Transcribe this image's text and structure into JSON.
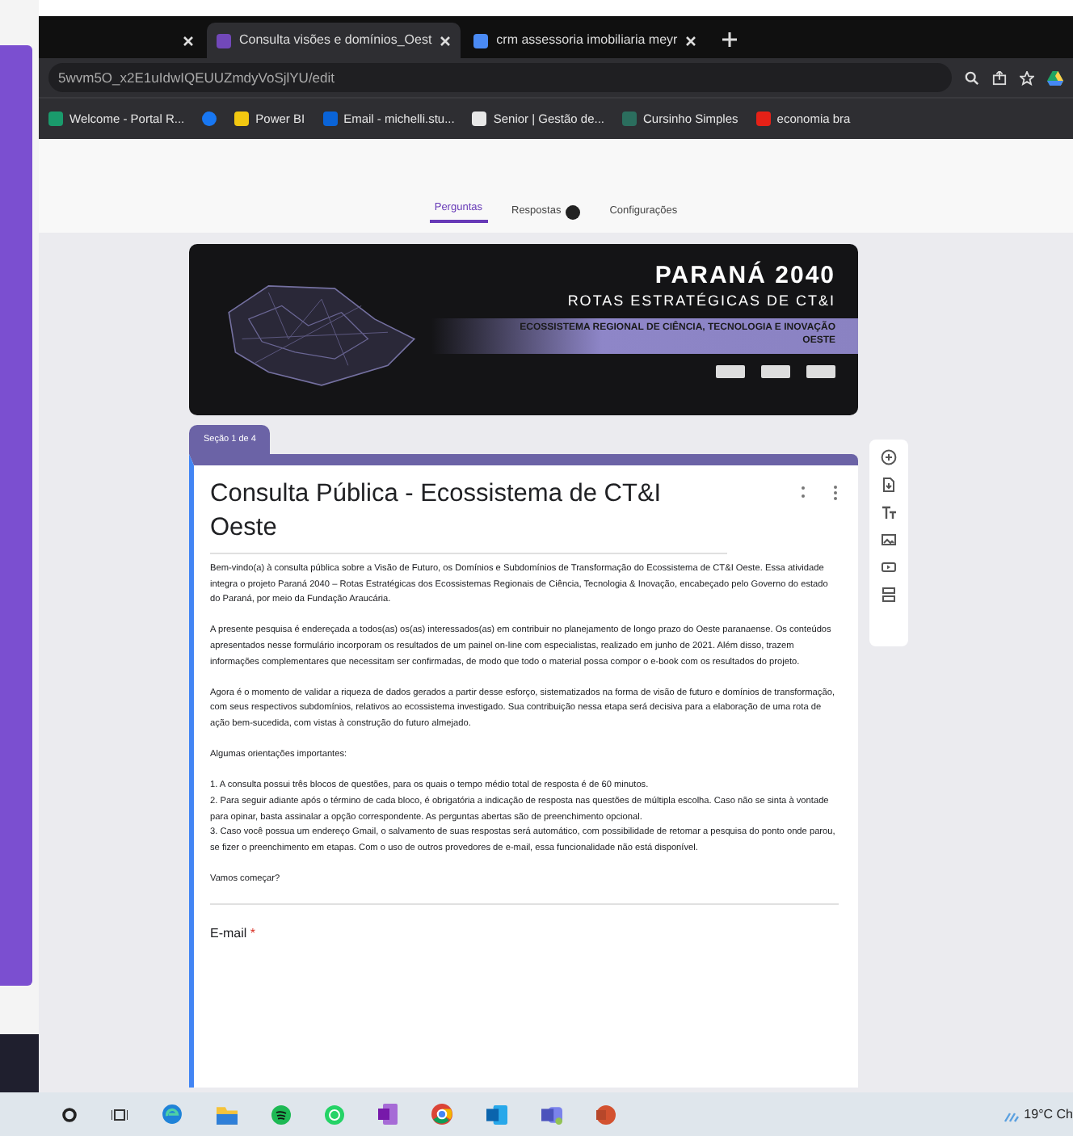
{
  "browser": {
    "tabs": [
      {
        "selected": false
      },
      {
        "title": "Consulta visões e domínios_Oest",
        "selected": true
      },
      {
        "title": "crm assessoria imobiliaria meyr",
        "selected": false
      }
    ],
    "url": "5wvm5O_x2E1uIdwIQEUUZmdyVoSjlYU/edit",
    "bookmarks": [
      {
        "label": "Welcome - Portal R...",
        "color": "#1a9b6c"
      },
      {
        "color": "#1877f2"
      },
      {
        "label": "Power BI",
        "color": "#f2c811"
      },
      {
        "label": "Email - michelli.stu...",
        "color": "#0a64d8"
      },
      {
        "label": "Senior | Gestão de...",
        "color": "#e8e8e8"
      },
      {
        "label": "Cursinho Simples",
        "color": "#2b6e5e"
      },
      {
        "label": "economia bra",
        "color": "#e62117"
      }
    ]
  },
  "form": {
    "tabs": [
      {
        "label": "Perguntas",
        "selected": true,
        "badge": false
      },
      {
        "label": "Respostas",
        "selected": false,
        "badge": true
      },
      {
        "label": "Configurações",
        "selected": false,
        "badge": false
      }
    ],
    "banner": {
      "title": "PARANÁ 2040",
      "subtitle": "ROTAS ESTRATÉGICAS DE CT&I",
      "region": "ECOSSISTEMA REGIONAL DE CIÊNCIA, TECNOLOGIA E INOVAÇÃO OESTE"
    },
    "section_label": "Seção 1 de 4",
    "title": "Consulta Pública - Ecossistema de CT&I Oeste",
    "description": [
      {
        "kind": "paragraph",
        "text": "Bem-vindo(a) à consulta pública sobre a Visão de Futuro, os Domínios e Subdomínios de Transformação do Ecossistema de CT&I Oeste. Essa atividade integra o projeto Paraná 2040 – Rotas Estratégicas dos Ecossistemas Regionais de Ciência, Tecnologia & Inovação, encabeçado pelo Governo do estado do Paraná, por meio da Fundação Araucária."
      },
      {
        "kind": "paragraph",
        "text": "A presente pesquisa é endereçada a todos(as) os(as) interessados(as) em contribuir no planejamento de longo prazo do Oeste paranaense. Os conteúdos apresentados nesse formulário incorporam os resultados de um painel on-line com especialistas, realizado em junho de 2021. Além disso, trazem informações complementares que necessitam ser confirmadas, de modo que todo o material possa compor o e-book com os resultados do projeto."
      },
      {
        "kind": "paragraph",
        "text": "Agora é o momento de validar a riqueza de dados gerados a partir desse esforço, sistematizados na forma de visão de futuro e domínios de transformação, com seus respectivos subdomínios, relativos ao ecossistema investigado. Sua contribuição nessa etapa será decisiva para a elaboração de uma rota de ação bem-sucedida, com vistas à construção do futuro almejado."
      },
      {
        "kind": "paragraph",
        "text": "Algumas orientações importantes:"
      },
      {
        "kind": "list",
        "items": [
          "1. A consulta possui três blocos de questões, para os quais o tempo médio total de resposta é de 60 minutos.",
          "2. Para seguir adiante após o término de cada bloco, é obrigatória a indicação de resposta nas questões de múltipla escolha. Caso não se sinta à vontade para opinar, basta assinalar a opção correspondente. As perguntas abertas são de preenchimento opcional.",
          "3. Caso você possua um endereço Gmail, o salvamento de suas respostas será automático, com possibilidade de retomar a pesquisa do ponto onde parou, se fizer o preenchimento em etapas. Com o uso de outros provedores de e-mail, essa funcionalidade não está disponível."
        ]
      },
      {
        "kind": "paragraph",
        "text": "Vamos começar?"
      }
    ],
    "question": {
      "label": "E-mail",
      "required": true,
      "required_mark": "*"
    }
  },
  "taskbar": {
    "weather": "19°C Ch"
  }
}
